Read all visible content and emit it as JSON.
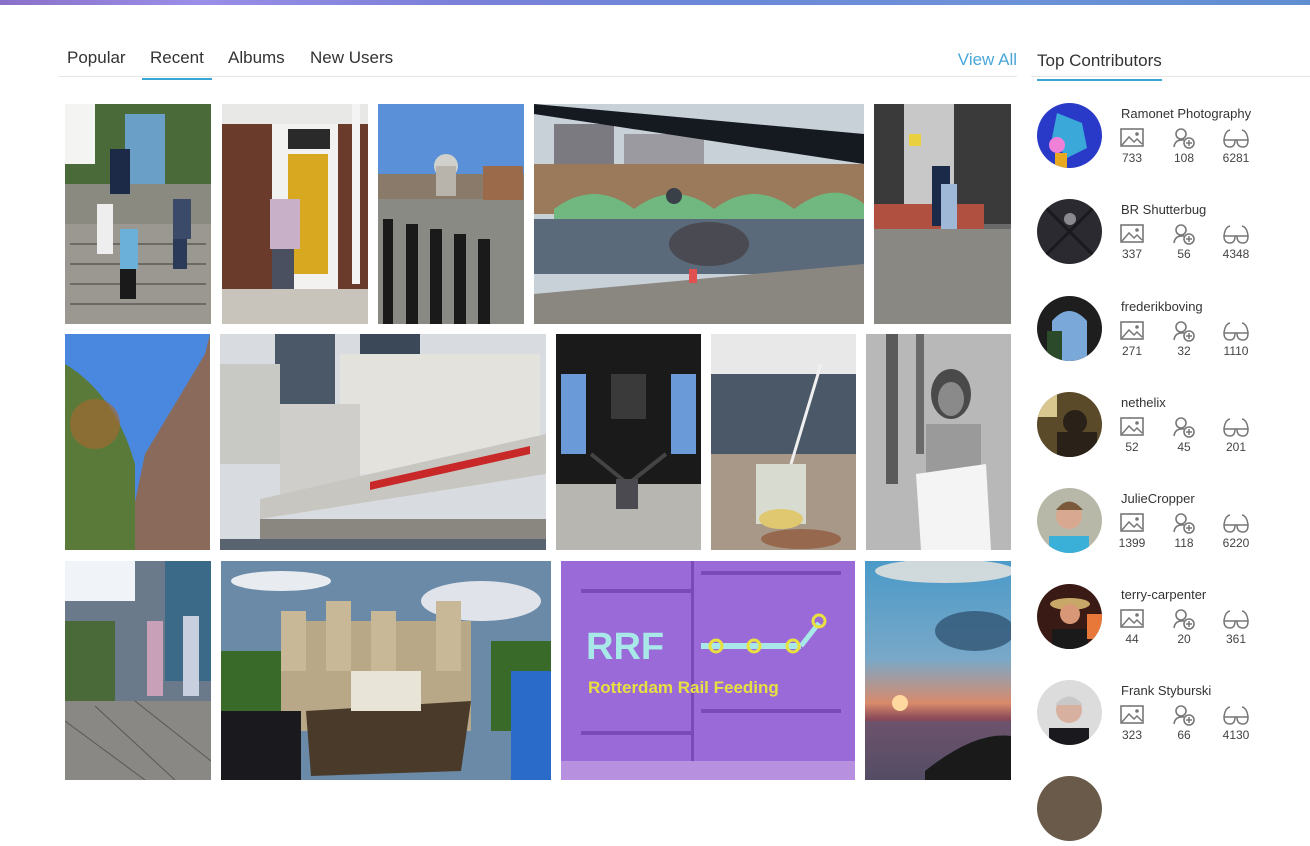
{
  "tabs": {
    "items": [
      {
        "label": "Popular",
        "active": false
      },
      {
        "label": "Recent",
        "active": true
      },
      {
        "label": "Albums",
        "active": false
      },
      {
        "label": "New Users",
        "active": false
      }
    ],
    "view_all_label": "View All"
  },
  "photos": [
    {
      "subject": "People descending stone stairs under trees"
    },
    {
      "subject": "Man entering yellow door of brick house"
    },
    {
      "subject": "St Paul's Cathedral across the Thames"
    },
    {
      "subject": "Pigeon on riverside wall with green bridge"
    },
    {
      "subject": "Children playing outside building"
    },
    {
      "subject": "Ornate building facade with tree and blue sky"
    },
    {
      "subject": "London Bridge with red buses"
    },
    {
      "subject": "Padlock and chain on railing"
    },
    {
      "subject": "Cocktail on wooden table"
    },
    {
      "subject": "Black and white portrait of woman"
    },
    {
      "subject": "Two girls walking on boardwalk"
    },
    {
      "subject": "Tower of London with old boat"
    },
    {
      "subject": "Purple rail car: Rotterdam Rail Feeding",
      "sign_text": "RRF",
      "sign_subtext": "Rotterdam Rail Feeding"
    },
    {
      "subject": "Sunset over the sea"
    }
  ],
  "sidebar": {
    "title": "Top Contributors",
    "stat_icons": [
      "photos-icon",
      "followers-icon",
      "views-icon"
    ],
    "contributors": [
      {
        "name": "Ramonet Photography",
        "photos": "733",
        "followers": "108",
        "views": "6281"
      },
      {
        "name": "BR Shutterbug",
        "photos": "337",
        "followers": "56",
        "views": "4348"
      },
      {
        "name": "frederikboving",
        "photos": "271",
        "followers": "32",
        "views": "1110"
      },
      {
        "name": "nethelix",
        "photos": "52",
        "followers": "45",
        "views": "201"
      },
      {
        "name": "JulieCropper",
        "photos": "1399",
        "followers": "118",
        "views": "6220"
      },
      {
        "name": "terry-carpenter",
        "photos": "44",
        "followers": "20",
        "views": "361"
      },
      {
        "name": "Frank Styburski",
        "photos": "323",
        "followers": "66",
        "views": "4130"
      }
    ]
  },
  "colors": {
    "accent": "#3aa6d6",
    "link": "#49a7d8",
    "text": "#333333",
    "icon": "#777777"
  }
}
